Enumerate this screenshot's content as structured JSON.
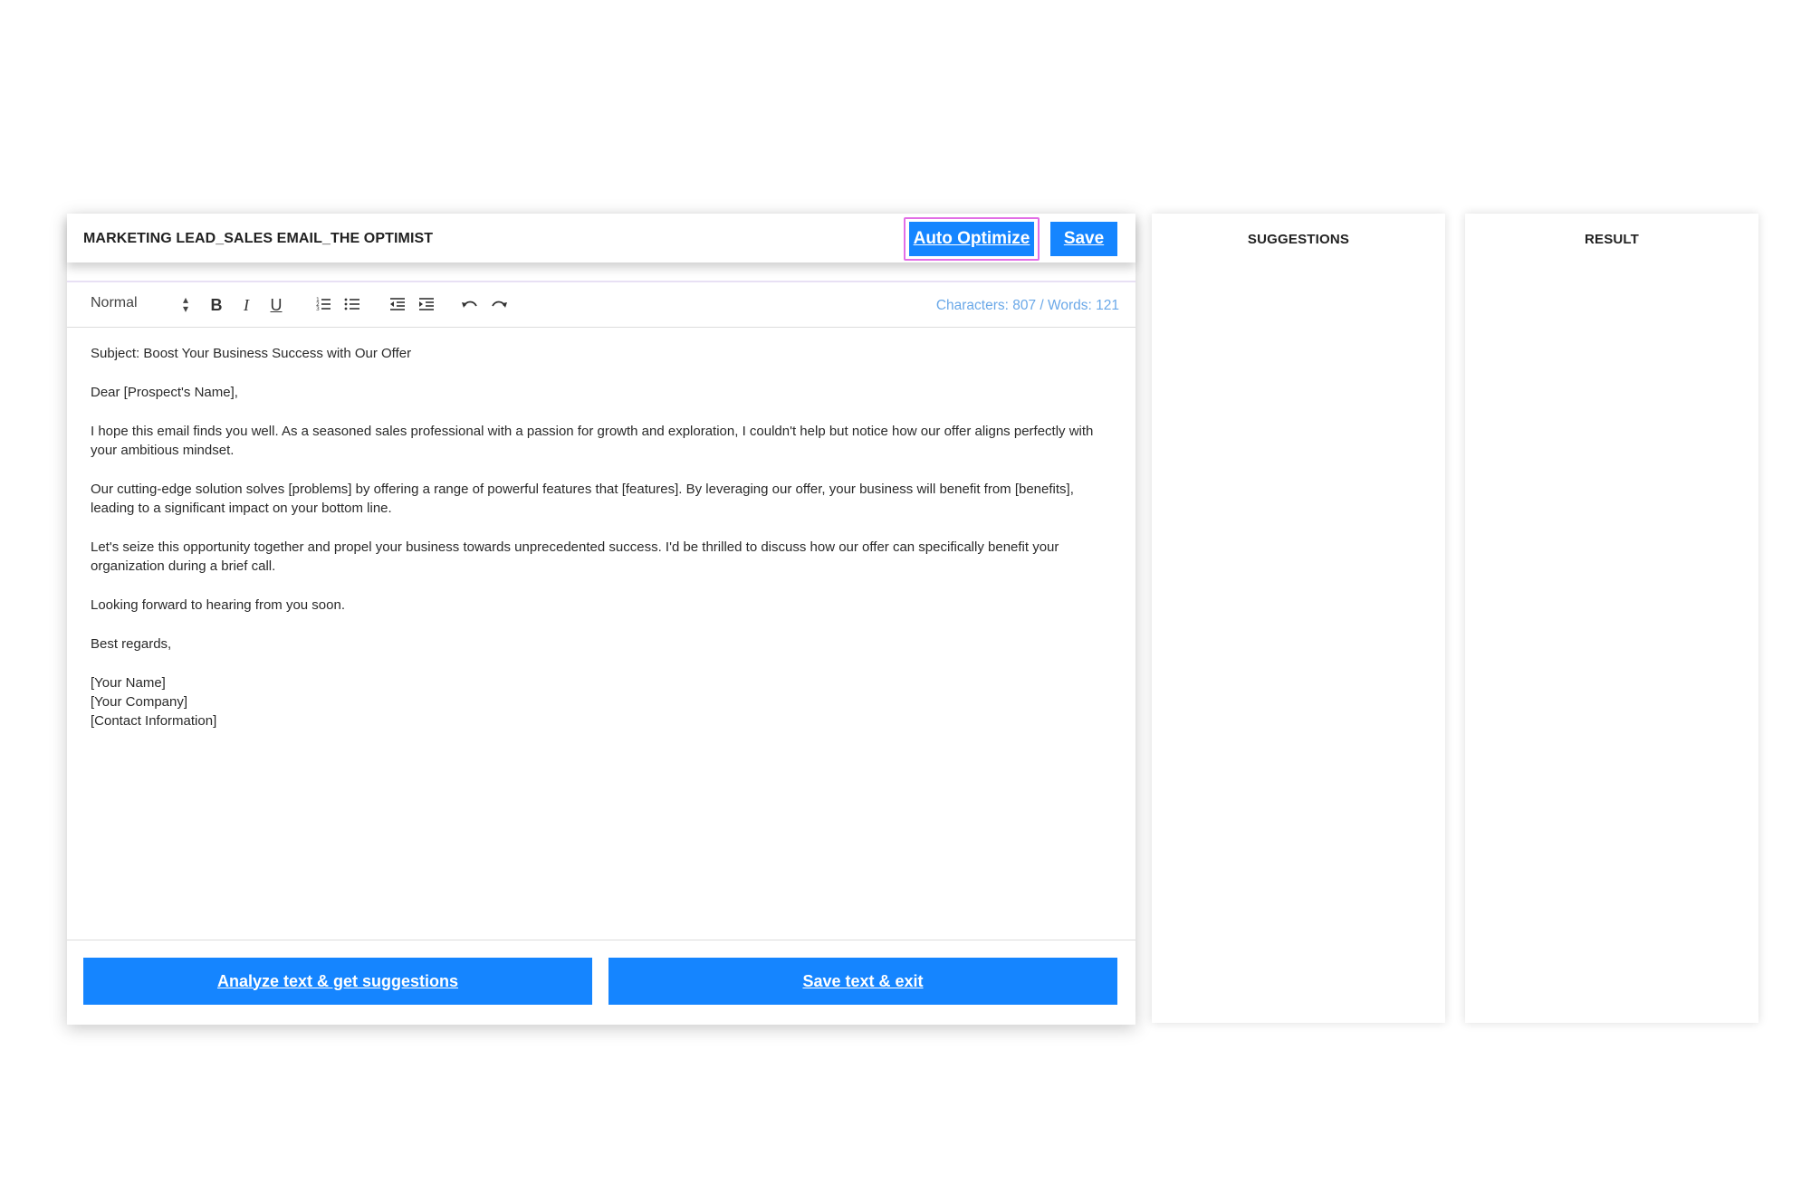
{
  "document": {
    "title": "MARKETING LEAD_SALES EMAIL_THE OPTIMIST"
  },
  "header": {
    "auto_optimize_label": "Auto Optimize",
    "save_label": "Save"
  },
  "toolbar": {
    "format_select_value": "Normal",
    "icons": [
      "bold-icon",
      "italic-icon",
      "underline-icon",
      "ordered-list-icon",
      "bullet-list-icon",
      "outdent-icon",
      "indent-icon",
      "undo-icon",
      "redo-icon"
    ],
    "bold_glyph": "B",
    "italic_glyph": "I",
    "underline_glyph": "U",
    "counter": "Characters: 807 / Words: 121"
  },
  "email": {
    "subject": "Subject: Boost Your Business Success with Our Offer",
    "greeting": "Dear [Prospect's Name],",
    "paragraph_1": "I hope this email finds you well. As a seasoned sales professional with a passion for growth and exploration, I couldn't help but notice how our offer aligns perfectly with your ambitious mindset.",
    "paragraph_2": "Our cutting-edge solution solves [problems] by offering a range of powerful features that [features]. By leveraging our offer, your business will benefit from [benefits], leading to a significant impact on your bottom line.",
    "paragraph_3": "Let's seize this opportunity together and propel your business towards unprecedented success. I'd be thrilled to discuss how our offer can specifically benefit your organization during a brief call.",
    "closing_line": "Looking forward to hearing from you soon.",
    "sign_off": "Best regards,",
    "signature_name": "[Your Name]",
    "signature_company": "[Your Company]",
    "signature_contact": "[Contact Information]"
  },
  "footer": {
    "analyze_label": "Analyze text & get suggestions",
    "save_exit_label": "Save text & exit"
  },
  "panels": {
    "suggestions_title": "SUGGESTIONS",
    "result_title": "RESULT"
  },
  "colors": {
    "primary_button": "#1585ff",
    "highlight_frame": "#e26ee6",
    "counter_text": "#6aa8e8"
  }
}
